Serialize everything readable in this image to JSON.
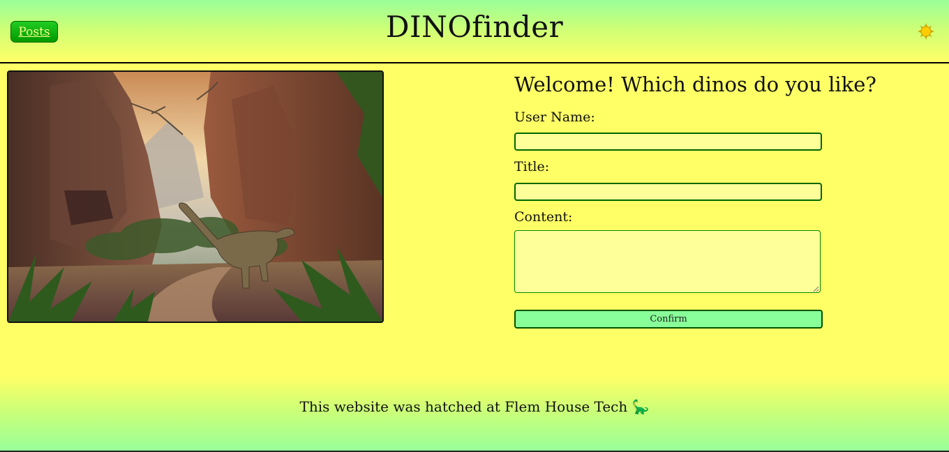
{
  "header": {
    "posts_label": "Posts",
    "title_main": "DINO",
    "title_suffix": "finder",
    "theme_icon": "sun-icon"
  },
  "hero": {
    "icon": "dinosaur-landscape-image"
  },
  "form": {
    "heading": "Welcome! Which dinos do you like?",
    "username_label": "User Name:",
    "username_value": "",
    "title_label": "Title:",
    "title_value": "",
    "content_label": "Content:",
    "content_value": "",
    "confirm_label": "Confirm"
  },
  "footer": {
    "text": "This website was hatched at Flem House Tech",
    "emoji": "🦕"
  },
  "colors": {
    "background": "#ffff66",
    "accent_green": "#009900",
    "field_bg": "#ffff99",
    "button_bg": "#88ff99"
  }
}
